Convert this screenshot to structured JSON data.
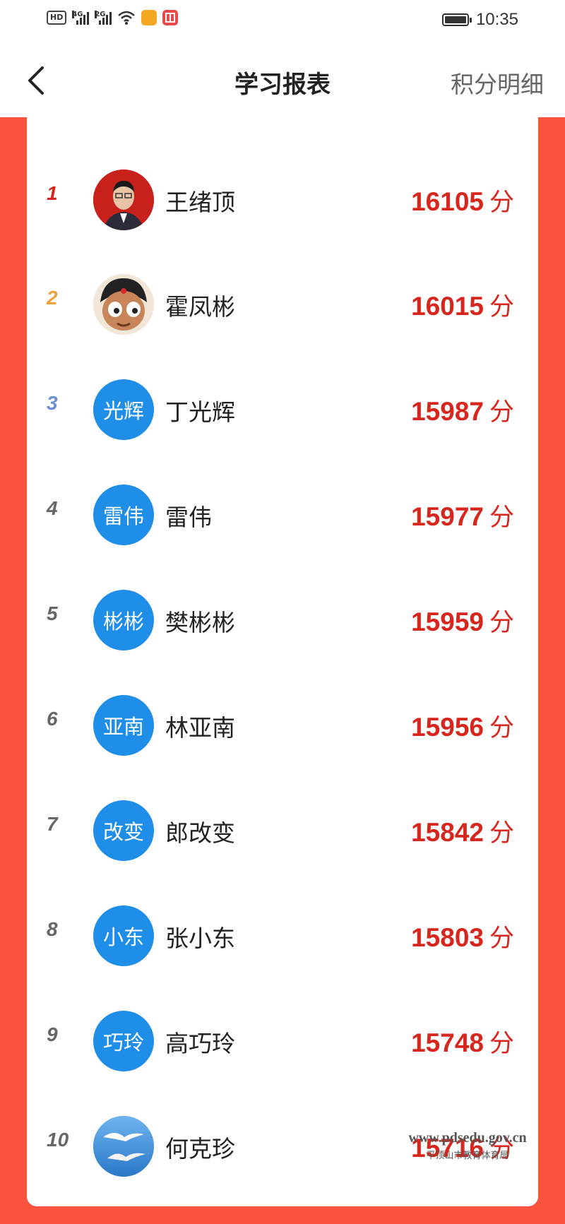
{
  "status_bar": {
    "hd_badge": "HD",
    "sim1_label": "4G",
    "sim2_label": "2G",
    "time": "10:35",
    "battery_level": 1.0
  },
  "nav": {
    "title": "学习报表",
    "right_action": "积分明细"
  },
  "leaderboard": [
    {
      "rank": "1",
      "name": "王绪顶",
      "avatar_text": "",
      "avatar_type": "photo",
      "score": "16105",
      "unit": "分"
    },
    {
      "rank": "2",
      "name": "霍凤彬",
      "avatar_text": "",
      "avatar_type": "cartoon",
      "score": "16015",
      "unit": "分"
    },
    {
      "rank": "3",
      "name": "丁光辉",
      "avatar_text": "光辉",
      "avatar_type": "text",
      "score": "15987",
      "unit": "分"
    },
    {
      "rank": "4",
      "name": "雷伟",
      "avatar_text": "雷伟",
      "avatar_type": "text",
      "score": "15977",
      "unit": "分"
    },
    {
      "rank": "5",
      "name": "樊彬彬",
      "avatar_text": "彬彬",
      "avatar_type": "text",
      "score": "15959",
      "unit": "分"
    },
    {
      "rank": "6",
      "name": "林亚南",
      "avatar_text": "亚南",
      "avatar_type": "text",
      "score": "15956",
      "unit": "分"
    },
    {
      "rank": "7",
      "name": "郎改变",
      "avatar_text": "改变",
      "avatar_type": "text",
      "score": "15842",
      "unit": "分"
    },
    {
      "rank": "8",
      "name": "张小东",
      "avatar_text": "小东",
      "avatar_type": "text",
      "score": "15803",
      "unit": "分"
    },
    {
      "rank": "9",
      "name": "高巧玲",
      "avatar_text": "巧玲",
      "avatar_type": "text",
      "score": "15748",
      "unit": "分"
    },
    {
      "rank": "10",
      "name": "何克珍",
      "avatar_text": "",
      "avatar_type": "birds",
      "score": "15716",
      "unit": "分"
    }
  ],
  "rank_colors": {
    "1": "#d7261d",
    "2": "#f0a03a",
    "3": "#6b8fd6",
    "default": "#666666"
  },
  "watermark": {
    "url": "www.pdsedu.gov.cn",
    "org": "平顶山市教育体育局"
  }
}
